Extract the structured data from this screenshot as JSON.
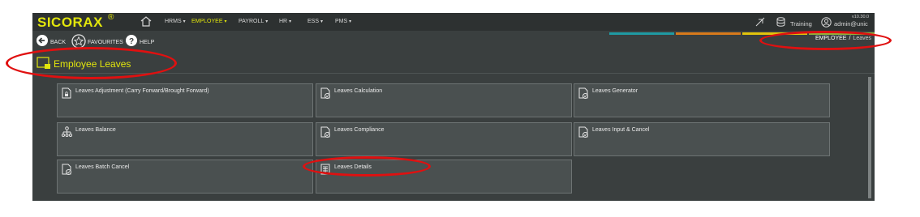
{
  "app": {
    "brand": "SICORAX",
    "brand_mark": "®",
    "version": "v10.30.0",
    "environment": "Training",
    "user": "admin@unic"
  },
  "nav": {
    "items": [
      {
        "label": "HRMS",
        "caret": "▾"
      },
      {
        "label": "EMPLOYEE",
        "caret": "▾"
      },
      {
        "label": "PAYROLL",
        "caret": "▾"
      },
      {
        "label": "HR",
        "caret": "▾"
      },
      {
        "label": "ESS",
        "caret": "▾"
      },
      {
        "label": "PMS",
        "caret": "▾"
      }
    ]
  },
  "toolbar": {
    "back_label": "BACK",
    "favourites_label": "FAVOURITES",
    "help_label": "HELP"
  },
  "breadcrumb": {
    "root": "EMPLOYEE",
    "separator": "/",
    "current": "Leaves"
  },
  "page": {
    "title": "Employee Leaves"
  },
  "tiles": [
    {
      "label": "Leaves Adjustment (Carry Forward/Brought Forward)",
      "icon": "doc-lock-icon"
    },
    {
      "label": "Leaves Calculation",
      "icon": "doc-check-icon"
    },
    {
      "label": "Leaves Generator",
      "icon": "doc-check-icon"
    },
    {
      "label": "Leaves Balance",
      "icon": "hierarchy-icon"
    },
    {
      "label": "Leaves Compliance",
      "icon": "doc-check-icon"
    },
    {
      "label": "Leaves Input & Cancel",
      "icon": "doc-check-icon"
    },
    {
      "label": "Leaves Batch Cancel",
      "icon": "doc-check-icon"
    },
    {
      "label": "Leaves Details",
      "icon": "doc-grid-icon"
    }
  ],
  "colors": {
    "accent": "#e2e60c",
    "background": "#3a3f3f",
    "tile": "#4a5050",
    "annotation": "#e01010",
    "strip": [
      "#1f9aa3",
      "#d87a1b",
      "#e2c40c",
      "#8fb13b"
    ]
  }
}
